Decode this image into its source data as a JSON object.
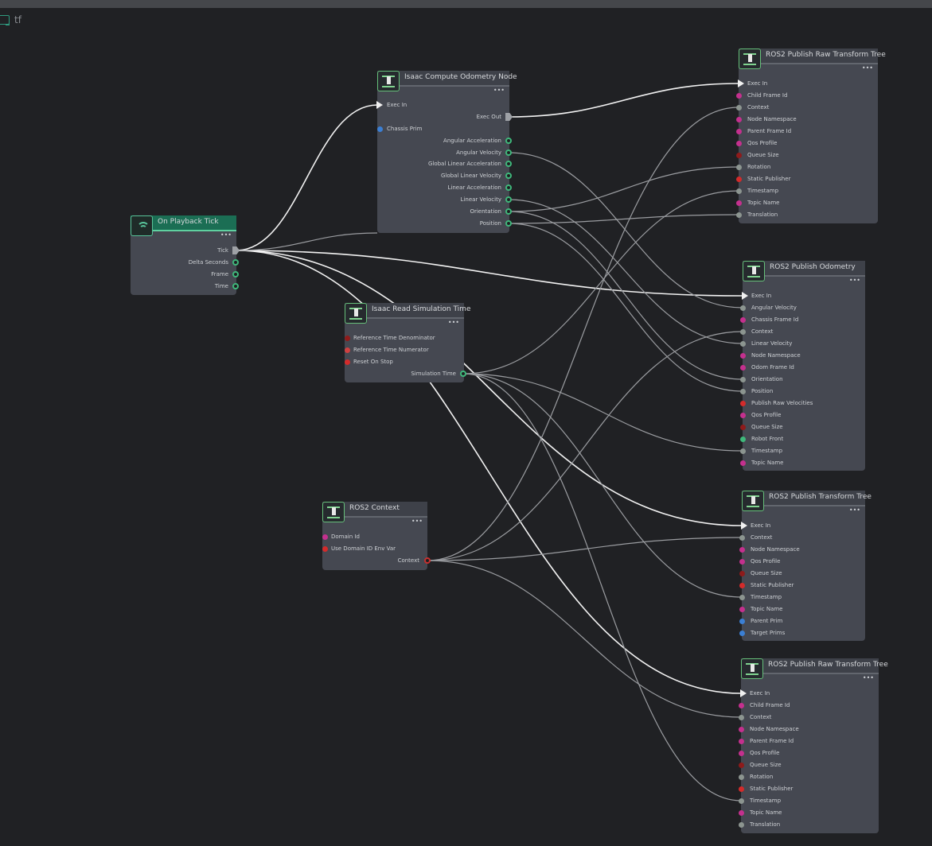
{
  "graph": {
    "name": "tf"
  },
  "nodes": {
    "playback": {
      "title": "On Playback Tick",
      "outputs": [
        "Tick",
        "Delta Seconds",
        "Frame",
        "Time"
      ]
    },
    "odom_compute": {
      "title": "Isaac Compute Odometry Node",
      "inputs": [
        "Exec In",
        "Chassis Prim"
      ],
      "outputs": [
        "Exec Out",
        "Angular Acceleration",
        "Angular Velocity",
        "Global Linear Acceleration",
        "Global Linear Velocity",
        "Linear Acceleration",
        "Linear Velocity",
        "Orientation",
        "Position"
      ]
    },
    "sim_time": {
      "title": "Isaac Read Simulation Time",
      "inputs": [
        "Reference Time Denominator",
        "Reference Time Numerator",
        "Reset On Stop"
      ],
      "outputs": [
        "Simulation Time"
      ]
    },
    "context": {
      "title": "ROS2 Context",
      "inputs": [
        "Domain Id",
        "Use Domain ID Env Var"
      ],
      "outputs": [
        "Context"
      ]
    },
    "raw_tf1": {
      "title": "ROS2 Publish Raw Transform Tree",
      "inputs": [
        "Exec In",
        "Child Frame Id",
        "Context",
        "Node Namespace",
        "Parent Frame Id",
        "Qos Profile",
        "Queue Size",
        "Rotation",
        "Static Publisher",
        "Timestamp",
        "Topic Name",
        "Translation"
      ]
    },
    "odom_pub": {
      "title": "ROS2 Publish Odometry",
      "inputs": [
        "Exec In",
        "Angular Velocity",
        "Chassis Frame Id",
        "Context",
        "Linear Velocity",
        "Node Namespace",
        "Odom Frame Id",
        "Orientation",
        "Position",
        "Publish Raw Velocities",
        "Qos Profile",
        "Queue Size",
        "Robot Front",
        "Timestamp",
        "Topic Name"
      ]
    },
    "tf_tree": {
      "title": "ROS2 Publish Transform Tree",
      "inputs": [
        "Exec In",
        "Context",
        "Node Namespace",
        "Qos Profile",
        "Queue Size",
        "Static Publisher",
        "Timestamp",
        "Topic Name",
        "Parent Prim",
        "Target Prims"
      ]
    },
    "raw_tf2": {
      "title": "ROS2 Publish Raw Transform Tree",
      "inputs": [
        "Exec In",
        "Child Frame Id",
        "Context",
        "Node Namespace",
        "Parent Frame Id",
        "Qos Profile",
        "Queue Size",
        "Rotation",
        "Static Publisher",
        "Timestamp",
        "Topic Name",
        "Translation"
      ]
    }
  },
  "menu_glyph": "•••",
  "colors": {
    "exec": "#f1f1f1",
    "string": "#c4308e",
    "bool": "#d32b2b",
    "uint": "#8e1b1b",
    "token": "#3b7fd4",
    "vector": "#3fb87b",
    "double": "#8c9590",
    "context": "#c8302f",
    "wire_exec": "#f2f2f2",
    "wire_data": "#9a9ca0"
  }
}
